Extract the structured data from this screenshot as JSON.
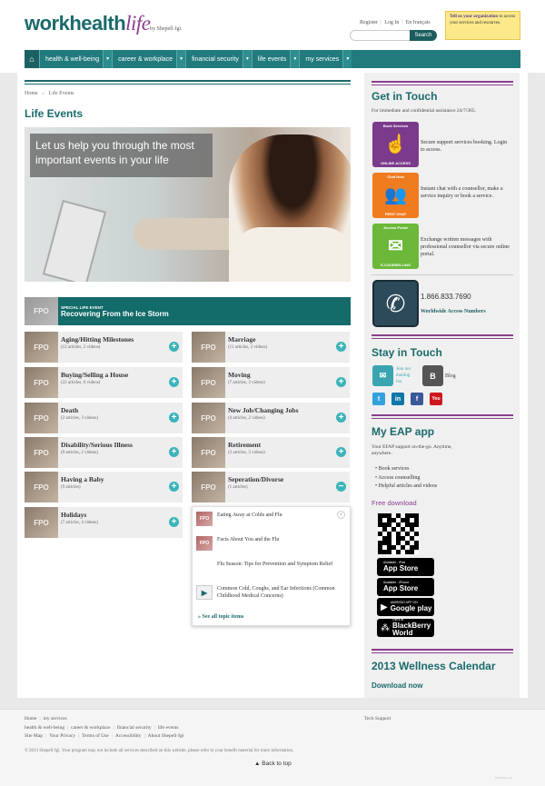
{
  "header": {
    "logo_work_health": "workhealth",
    "logo_life": "life",
    "byline": "by Shepell·fgi",
    "links": [
      "Register",
      "Log In",
      "En français"
    ],
    "search_button": "Search",
    "tell_title": "Tell us your organization",
    "tell_text": " to access your services and resources."
  },
  "nav": {
    "home_icon": "home-icon",
    "items": [
      "health & well-being",
      "career & workplace",
      "financial security",
      "life events",
      "my services"
    ]
  },
  "breadcrumb": {
    "home": "Home",
    "separator": "»",
    "current": "Life Events"
  },
  "page_title": "Life Events",
  "hero_caption": "Let us help you through the most important events in your life",
  "special": {
    "thumb": "FPO",
    "kicker": "SPECIAL LIFE EVENT",
    "title": "Recovering From the Ice Storm"
  },
  "topics": [
    {
      "name": "Aging/Hitting Milestones",
      "meta": "(12 articles, 2 videos)",
      "thumb": "FPO",
      "action": "+"
    },
    {
      "name": "Marriage",
      "meta": "(11 articles, 3 videos)",
      "thumb": "FPO",
      "action": "+"
    },
    {
      "name": "Buying/Selling a House",
      "meta": "(22 articles, 6 videos)",
      "thumb": "FPO",
      "action": "+"
    },
    {
      "name": "Moving",
      "meta": "(7 articles, 3 videos)",
      "thumb": "FPO",
      "action": "+"
    },
    {
      "name": "Death",
      "meta": "(2 articles, 3 videos)",
      "thumb": "FPO",
      "action": "+"
    },
    {
      "name": "New Job/Changing Jobs",
      "meta": "(4 articles, 2 videos)",
      "thumb": "FPO",
      "action": "+"
    },
    {
      "name": "Disability/Serious Illness",
      "meta": "(9 articles, 2 videos)",
      "thumb": "FPO",
      "action": "+"
    },
    {
      "name": "Retirement",
      "meta": "(3 articles, 3 videos)",
      "thumb": "FPO",
      "action": "+"
    },
    {
      "name": "Having a Baby",
      "meta": "(9 articles)",
      "thumb": "FPO",
      "action": "+"
    },
    {
      "name": "Seperation/Divorse",
      "meta": "(1 articles)",
      "thumb": "FPO",
      "action": "−"
    },
    {
      "name": "Holidays",
      "meta": "(7 articles, 4 videos)",
      "thumb": "FPO",
      "action": "+"
    }
  ],
  "dropdown": {
    "close": "×",
    "items": [
      {
        "title": "Eating Away at Colds and Flu",
        "thumb": "FPO"
      },
      {
        "title": "Facts About You and the Flu",
        "thumb": "FPO"
      },
      {
        "title": "Flu Season: Tips for Prevention and Symptom Relief",
        "thumb": ""
      },
      {
        "title": "Common Cold, Coughs, and Ear Infections (Common Childhood Medical Concerns)",
        "thumb": "▶"
      }
    ],
    "see_all": "» See all topic items"
  },
  "sidebar": {
    "get_in_touch": "Get in Touch",
    "touch_intro": "For immediate and confidential assistance 24/7/365.",
    "services": [
      {
        "tile_top": "Book Services",
        "tile_bottom": "ONLINE ACCESS",
        "desc": "Secure support services booking. Login to access.",
        "color": "#7b3a8c",
        "icon": "touch-icon"
      },
      {
        "tile_top": "Chat Now",
        "tile_bottom": "FIRST CHAT",
        "desc": "Instant chat with a counsellor, make a service inquiry or book a service.",
        "color": "#f07c20",
        "icon": "chat-people-icon"
      },
      {
        "tile_top": "Access Portal",
        "tile_bottom": "E-COUNSELLING",
        "desc": "Exchange written messages with professional counsellor via secure online portal.",
        "color": "#6cb83a",
        "icon": "message-icon"
      }
    ],
    "phone": "1.866.833.7690",
    "phone_link": "Worldwide Access Numbers",
    "stay_in_touch": "Stay in Touch",
    "mailing_list": "Join our mailing list",
    "blog": "Blog",
    "social": [
      "twitter-icon",
      "linkedin-icon",
      "facebook-icon",
      "youtube-icon"
    ],
    "my_eap": "My EAP app",
    "eap_intro": "Your EFAP support on-the-go. Anytime, anywhere.",
    "eap_features": [
      "Book services",
      "Access counselling",
      "Helpful articles and videos"
    ],
    "free_download": "Free download",
    "stores": [
      {
        "l1": "Available - iPad",
        "l2": "App Store",
        "icon": "apple-icon"
      },
      {
        "l1": "Available - iPhone",
        "l2": "App Store",
        "icon": "apple-icon"
      },
      {
        "l1": "ANDROID APP ON",
        "l2": "Google play",
        "icon": "play-icon"
      },
      {
        "l1": "Get it at",
        "l2": "BlackBerry World",
        "icon": "blackberry-icon"
      }
    ],
    "calendar": "2013 Wellness Calendar",
    "download_now": "Download now"
  },
  "footer": {
    "row1": [
      "Home",
      "my services"
    ],
    "row2": [
      "health & well-being",
      "career & workplace",
      "financial security",
      "life events"
    ],
    "row3": [
      "Site Map",
      "Your Privacy",
      "Terms of Use",
      "Accessibility",
      "About Shepell·fgi"
    ],
    "tech_support": "Tech Support",
    "copyright": "© 2013 Shepell·fgi. Your program may not include all services described on this website, please refer to your benefit material for more information.",
    "back_to_top": "Back to top",
    "small": "JAPTER1a.lo"
  }
}
